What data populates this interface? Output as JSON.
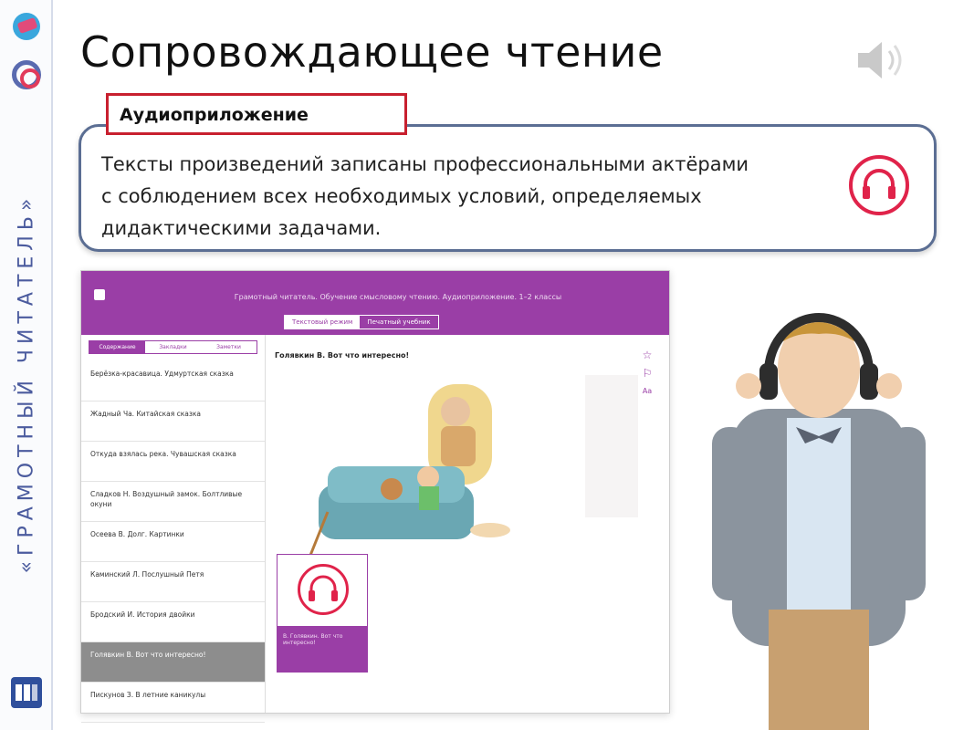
{
  "slide": {
    "title": "Сопровождающее чтение",
    "label": "Аудиоприложение",
    "callout_lines": [
      "Тексты произведений записаны профессиональными актёрами",
      "с соблюдением всех необходимых условий, определяемых",
      "дидактическими задачами."
    ]
  },
  "brand": {
    "vertical_text": "«ГРАМОТНЫЙ ЧИТАТЕЛЬ»",
    "accent_purple": "#9a3ea6",
    "accent_red": "#e0234a",
    "callout_border": "#5b6e93",
    "label_border": "#c8202f"
  },
  "app": {
    "header_title": "Грамотный читатель. Обучение смысловому чтению. Аудиоприложение. 1–2 классы",
    "mode_tabs": [
      "Текстовый режим",
      "Печатный учебник"
    ],
    "sidebar_tabs": [
      "Содержание",
      "Закладки",
      "Заметки"
    ],
    "items": [
      "Берёзка-красавица. Удмуртская сказка",
      "Жадный Ча. Китайская сказка",
      "Откуда взялась река. Чувашская сказка",
      "Сладков Н. Воздушный замок. Болтливые окуни",
      "Осеева В. Долг. Картинки",
      "Каминский Л. Послушный Петя",
      "Бродский И. История двойки",
      "Голявкин В. Вот что интересно!",
      "Пискунов З. В летние каникулы"
    ],
    "selected_index": 7,
    "content_title": "Голявкин В. Вот что интересно!",
    "audio_caption": "В. Голявкин. Вот что интересно!",
    "tool_icons": [
      "star-icon",
      "bookmark-icon",
      "font-size-icon"
    ],
    "font_size_label": "Aa"
  }
}
